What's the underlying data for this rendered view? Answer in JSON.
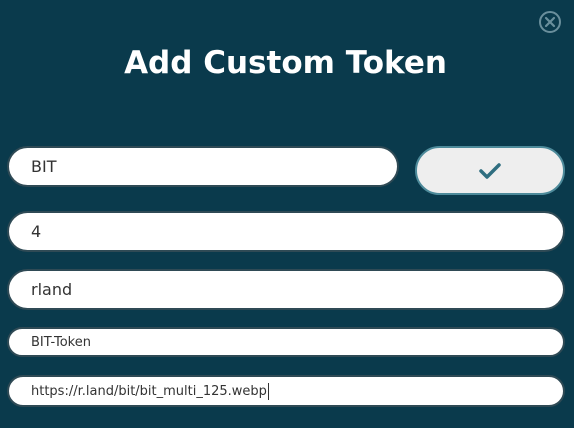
{
  "dialog": {
    "title": "Add Custom Token",
    "close_icon": "close-circle-icon",
    "confirm_icon": "checkmark-icon",
    "accent_color": "#4d8a9a",
    "background_color": "#0a3a4c"
  },
  "fields": {
    "symbol": "BIT",
    "decimals": "4",
    "network": "rland",
    "name": "BIT-Token",
    "image_url": "https://r.land/bit/bit_multi_125.webp"
  }
}
